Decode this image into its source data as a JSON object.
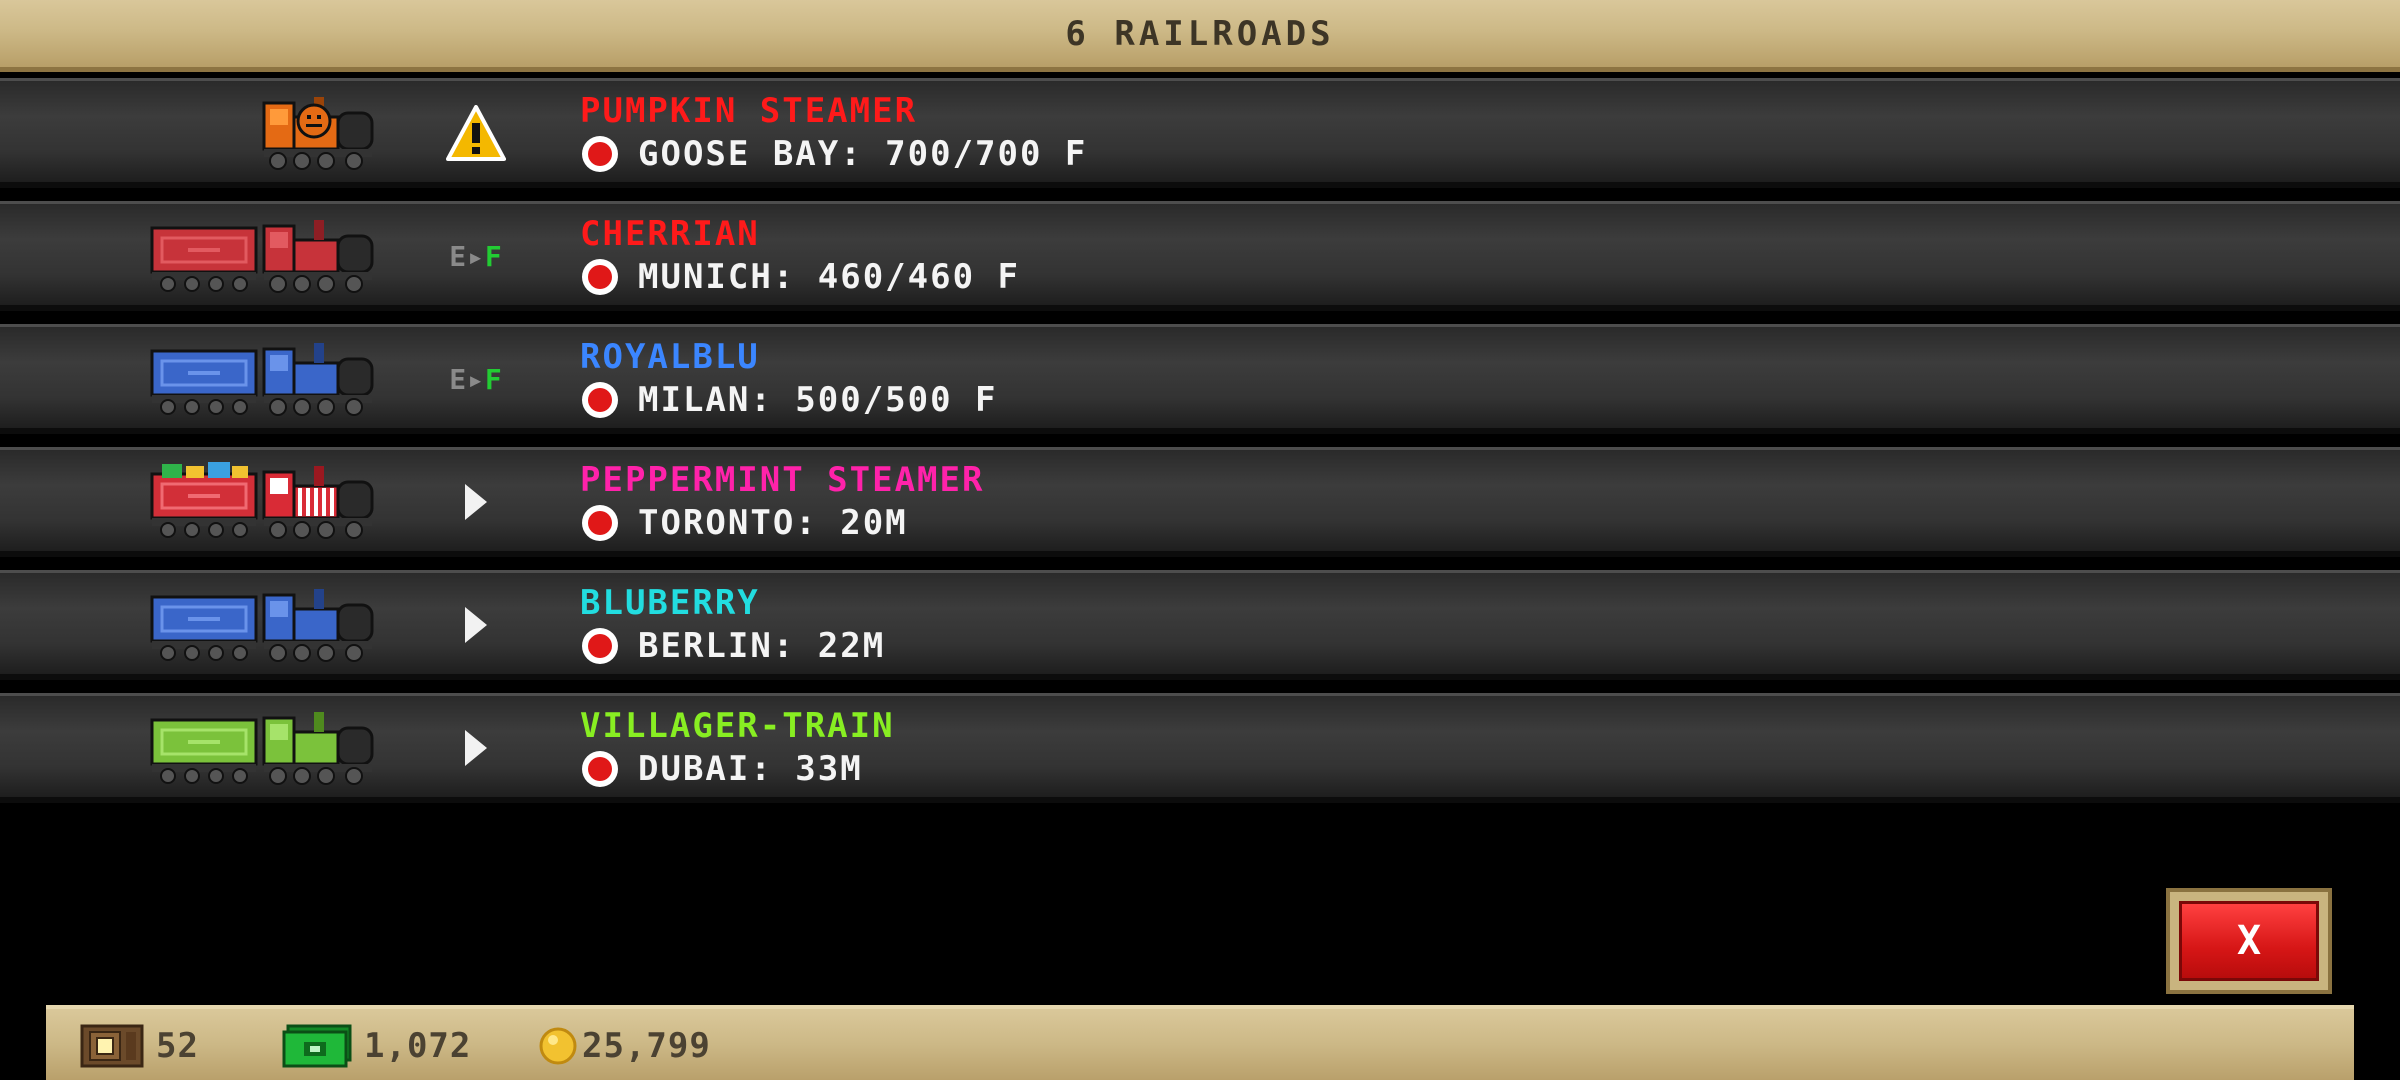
{
  "header": {
    "title": "6 RAILROADS"
  },
  "railroads": [
    {
      "name": "PUMPKIN STEAMER",
      "name_color": "#ff1a1a",
      "status": "warning",
      "status_icon": "warning-icon",
      "destination": "GOOSE BAY: 700/700 F",
      "cars": [
        "pumpkin-locomotive"
      ]
    },
    {
      "name": "CHERRIAN",
      "name_color": "#ff1a1a",
      "status": "empty-to-full",
      "status_icon": "empty-to-full-icon",
      "status_e": "E",
      "status_f": "F",
      "destination": "MUNICH: 460/460 F",
      "cars": [
        "red-tender",
        "red-locomotive"
      ]
    },
    {
      "name": "ROYALBLU",
      "name_color": "#3b86ff",
      "status": "empty-to-full",
      "status_icon": "empty-to-full-icon",
      "status_e": "E",
      "status_f": "F",
      "destination": "MILAN: 500/500 F",
      "cars": [
        "blue-tender",
        "blue-locomotive"
      ]
    },
    {
      "name": "PEPPERMINT STEAMER",
      "name_color": "#ff22aa",
      "status": "moving",
      "status_icon": "play-arrow-icon",
      "destination": "TORONTO: 20M",
      "cars": [
        "gift-tender",
        "peppermint-locomotive"
      ]
    },
    {
      "name": "BLUBERRY",
      "name_color": "#22dde0",
      "status": "moving",
      "status_icon": "play-arrow-icon",
      "destination": "BERLIN: 22M",
      "cars": [
        "blue-tender",
        "blue-locomotive"
      ]
    },
    {
      "name": "VILLAGER-TRAIN",
      "name_color": "#88ee22",
      "status": "moving",
      "status_icon": "play-arrow-icon",
      "destination": "DUBAI: 33M",
      "cars": [
        "green-tender",
        "green-locomotive"
      ]
    }
  ],
  "close_button": {
    "label": "X"
  },
  "resources": {
    "crates": "52",
    "cash": "1,072",
    "coins": "25,799"
  },
  "colors": {
    "destination_dot": "#e01818",
    "close_button": "#e01818",
    "panel_tan": "#ccb886"
  }
}
